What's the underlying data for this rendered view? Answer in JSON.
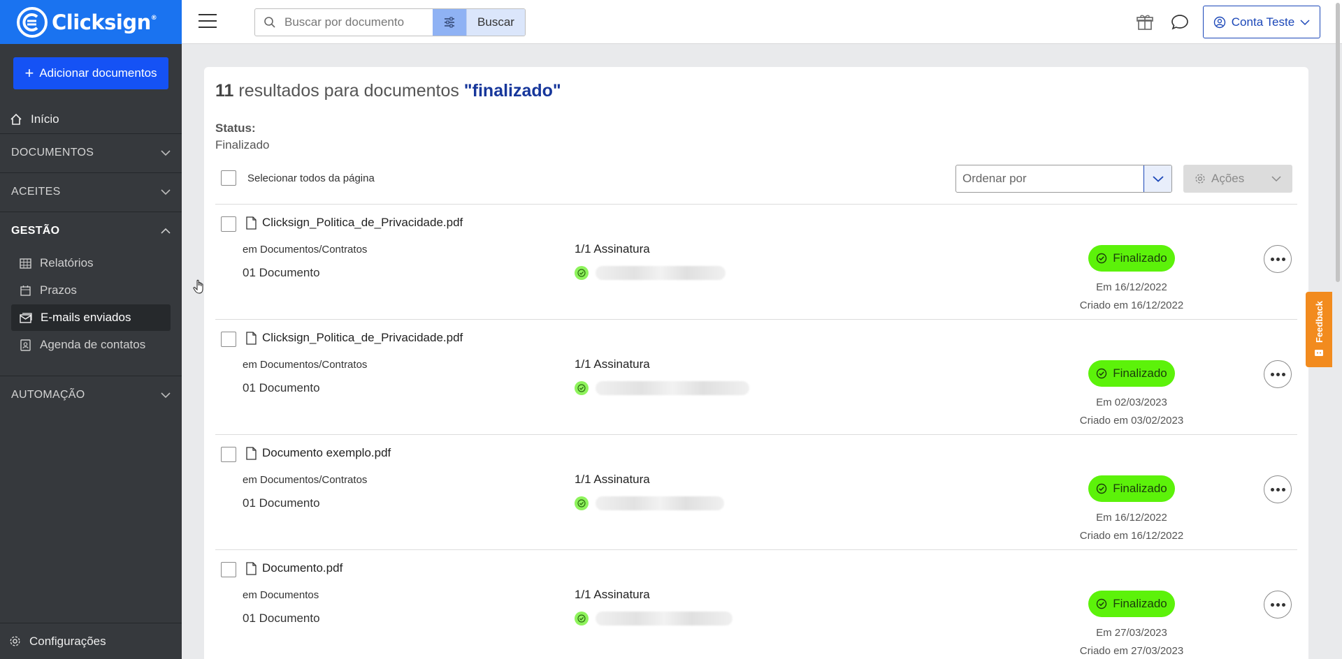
{
  "brand": {
    "name": "Clicksign",
    "mark": "®"
  },
  "sidebar": {
    "add_button": "Adicionar documentos",
    "home": "Início",
    "sections": [
      {
        "label": "DOCUMENTOS"
      },
      {
        "label": "ACEITES"
      },
      {
        "label": "GESTÃO"
      },
      {
        "label": "AUTOMAÇÃO"
      }
    ],
    "gestao_items": [
      {
        "label": "Relatórios"
      },
      {
        "label": "Prazos"
      },
      {
        "label": "E-mails enviados"
      },
      {
        "label": "Agenda de contatos"
      }
    ],
    "settings": "Configurações"
  },
  "topbar": {
    "search_placeholder": "Buscar por documento",
    "search_button": "Buscar",
    "account": "Conta Teste"
  },
  "results": {
    "count": "11",
    "text": " resultados para documentos ",
    "query": "\"finalizado\"",
    "status_label": "Status:",
    "status_value": "Finalizado",
    "select_all": "Selecionar todos da página",
    "order_placeholder": "Ordenar por",
    "actions": "Ações"
  },
  "documents": [
    {
      "name": "Clicksign_Politica_de_Privacidade.pdf",
      "folder": "em Documentos/Contratos",
      "count": "01 Documento",
      "signatures": "1/1 Assinatura",
      "status": "Finalizado",
      "finished": "Em 16/12/2022",
      "created": "Criado em 16/12/2022"
    },
    {
      "name": "Clicksign_Politica_de_Privacidade.pdf",
      "folder": "em Documentos/Contratos",
      "count": "01 Documento",
      "signatures": "1/1 Assinatura",
      "status": "Finalizado",
      "finished": "Em 02/03/2023",
      "created": "Criado em 03/02/2023"
    },
    {
      "name": "Documento exemplo.pdf",
      "folder": "em Documentos/Contratos",
      "count": "01 Documento",
      "signatures": "1/1 Assinatura",
      "status": "Finalizado",
      "finished": "Em 16/12/2022",
      "created": "Criado em 16/12/2022"
    },
    {
      "name": "Documento.pdf",
      "folder": "em Documentos",
      "count": "01 Documento",
      "signatures": "1/1 Assinatura",
      "status": "Finalizado",
      "finished": "Em 27/03/2023",
      "created": "Criado em 27/03/2023"
    }
  ],
  "feedback": "Feedback",
  "colors": {
    "brand_blue": "#1a73f0",
    "sidebar_bg": "#36393d",
    "status_green": "#5cf20a",
    "query_blue": "#17379b",
    "feedback_orange": "#f28b1e"
  }
}
